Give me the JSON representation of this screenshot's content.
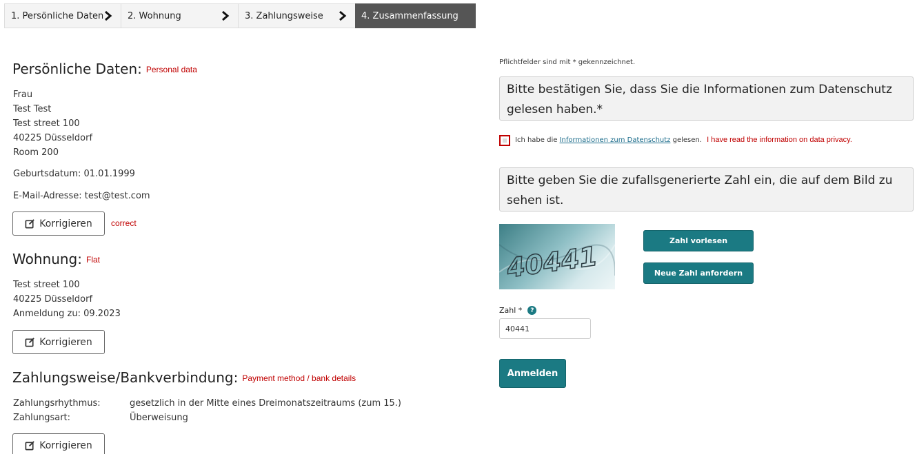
{
  "stepper": {
    "steps": [
      {
        "label": "1. Persönliche Daten"
      },
      {
        "label": "2. Wohnung"
      },
      {
        "label": "3. Zahlungsweise"
      },
      {
        "label": "4. Zusammenfassung"
      }
    ],
    "active_step": 4
  },
  "personal": {
    "heading": "Persönliche Daten:",
    "annotation": "Personal data",
    "salutation": "Frau",
    "name": "Test Test",
    "street": "Test street 100",
    "city": "40225 Düsseldorf",
    "room": "Room 200",
    "birthdate": "Geburtsdatum: 01.01.1999",
    "email": "E-Mail-Adresse: test@test.com",
    "correct_label": "Korrigieren",
    "correct_annotation": "correct"
  },
  "flat": {
    "heading": "Wohnung:",
    "annotation": "Flat",
    "street": "Test street 100",
    "city": "40225 Düsseldorf",
    "registration": "Anmeldung zu: 09.2023",
    "correct_label": "Korrigieren"
  },
  "payment": {
    "heading": "Zahlungsweise/Bankverbindung:",
    "annotation": "Payment method / bank details",
    "rhythm_label": "Zahlungsrhythmus:",
    "rhythm_value": "gesetzlich in der Mitte eines Dreimonatszeitraums (zum 15.)",
    "type_label": "Zahlungsart:",
    "type_value": "Überweisung",
    "correct_label": "Korrigieren"
  },
  "form": {
    "required_note": "Pflichtfelder sind mit * gekennzeichnet.",
    "privacy_box": "Bitte bestätigen Sie, dass Sie die Informationen zum Datenschutz gelesen haben.*",
    "privacy_checkbox_prefix": "Ich habe die",
    "privacy_link": "Informationen zum Datenschutz",
    "privacy_checkbox_suffix": "gelesen.",
    "privacy_annotation": "I have read the information on data privacy.",
    "captcha_box": "Bitte geben Sie die zufallsgenerierte Zahl ein, die auf dem Bild zu sehen ist.",
    "captcha_image_text": "40441",
    "read_aloud_button": "Zahl vorlesen",
    "new_number_button": "Neue Zahl anfordern",
    "number_label": "Zahl *",
    "number_help": "?",
    "number_value": "40441",
    "submit_button": "Anmelden"
  },
  "colors": {
    "accent": "#1b7a83",
    "annotation": "#c00000",
    "active_step": "#555555"
  }
}
